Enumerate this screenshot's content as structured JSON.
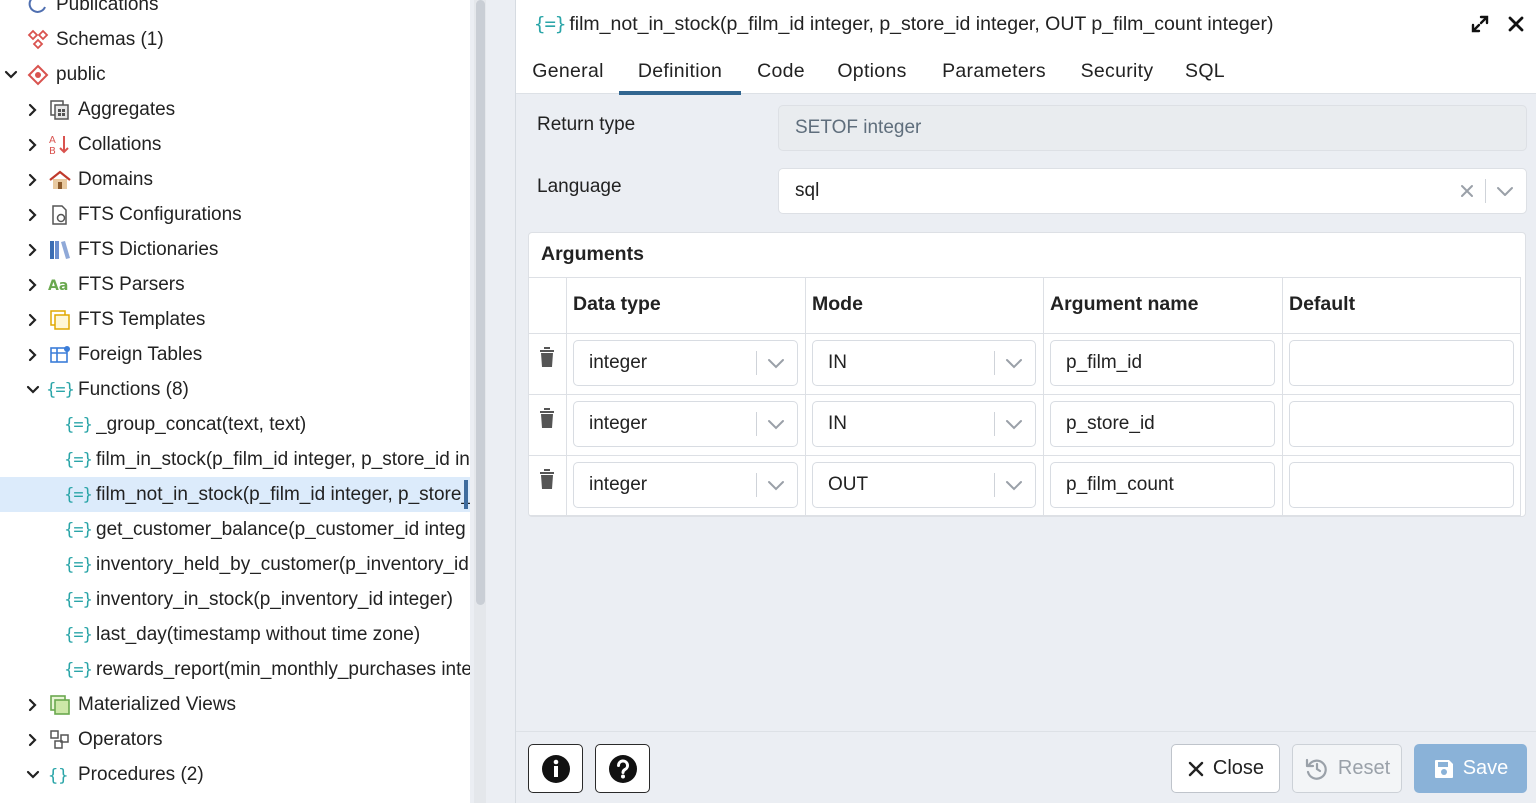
{
  "tree": {
    "items": [
      {
        "label": "Publications",
        "icon": "publication-icon",
        "expander": "none",
        "indent": 0
      },
      {
        "label": "Schemas (1)",
        "icon": "schemas-icon",
        "expander": "none",
        "indent": 0
      },
      {
        "label": "public",
        "icon": "schema-icon",
        "expander": "open",
        "indent": 0
      },
      {
        "label": "Aggregates",
        "icon": "aggregate-icon",
        "expander": "closed",
        "indent": 1
      },
      {
        "label": "Collations",
        "icon": "collation-icon",
        "expander": "closed",
        "indent": 1
      },
      {
        "label": "Domains",
        "icon": "domain-icon",
        "expander": "closed",
        "indent": 1
      },
      {
        "label": "FTS Configurations",
        "icon": "fts-configuration-icon",
        "expander": "closed",
        "indent": 1
      },
      {
        "label": "FTS Dictionaries",
        "icon": "fts-dictionary-icon",
        "expander": "closed",
        "indent": 1
      },
      {
        "label": "FTS Parsers",
        "icon": "fts-parser-icon",
        "expander": "closed",
        "indent": 1
      },
      {
        "label": "FTS Templates",
        "icon": "fts-template-icon",
        "expander": "closed",
        "indent": 1
      },
      {
        "label": "Foreign Tables",
        "icon": "foreign-table-icon",
        "expander": "closed",
        "indent": 1
      },
      {
        "label": "Functions (8)",
        "icon": "functions-icon",
        "expander": "open",
        "indent": 1
      },
      {
        "label": "_group_concat(text, text)",
        "icon": "function-icon",
        "expander": "none",
        "indent": 2
      },
      {
        "label": "film_in_stock(p_film_id integer, p_store_id in",
        "icon": "function-icon",
        "expander": "none",
        "indent": 2
      },
      {
        "label": "film_not_in_stock(p_film_id integer, p_store_",
        "icon": "function-icon",
        "expander": "none",
        "indent": 2,
        "selected": true
      },
      {
        "label": "get_customer_balance(p_customer_id integ",
        "icon": "function-icon",
        "expander": "none",
        "indent": 2
      },
      {
        "label": "inventory_held_by_customer(p_inventory_id",
        "icon": "function-icon",
        "expander": "none",
        "indent": 2
      },
      {
        "label": "inventory_in_stock(p_inventory_id integer)",
        "icon": "function-icon",
        "expander": "none",
        "indent": 2
      },
      {
        "label": "last_day(timestamp without time zone)",
        "icon": "function-icon",
        "expander": "none",
        "indent": 2
      },
      {
        "label": "rewards_report(min_monthly_purchases inte",
        "icon": "function-icon",
        "expander": "none",
        "indent": 2
      },
      {
        "label": "Materialized Views",
        "icon": "materialized-view-icon",
        "expander": "closed",
        "indent": 1
      },
      {
        "label": "Operators",
        "icon": "operator-icon",
        "expander": "closed",
        "indent": 1
      },
      {
        "label": "Procedures (2)",
        "icon": "procedures-icon",
        "expander": "open",
        "indent": 1
      }
    ]
  },
  "dialog": {
    "title": "film_not_in_stock(p_film_id integer, p_store_id integer, OUT p_film_count integer)",
    "tabs": [
      "General",
      "Definition",
      "Code",
      "Options",
      "Parameters",
      "Security",
      "SQL"
    ],
    "active_tab": "Definition",
    "return_type_label": "Return type",
    "return_type_value": "SETOF integer",
    "language_label": "Language",
    "language_value": "sql",
    "arguments": {
      "title": "Arguments",
      "columns": [
        "Data type",
        "Mode",
        "Argument name",
        "Default"
      ],
      "rows": [
        {
          "data_type": "integer",
          "mode": "IN",
          "name": "p_film_id",
          "default": ""
        },
        {
          "data_type": "integer",
          "mode": "IN",
          "name": "p_store_id",
          "default": ""
        },
        {
          "data_type": "integer",
          "mode": "OUT",
          "name": "p_film_count",
          "default": ""
        }
      ]
    },
    "footer": {
      "close_label": "Close",
      "reset_label": "Reset",
      "save_label": "Save"
    }
  },
  "colors": {
    "accent": "#326690",
    "function_icon": "#2aa5a8",
    "save_button": "#8ab2d8",
    "selected_row": "#dcebfb"
  }
}
